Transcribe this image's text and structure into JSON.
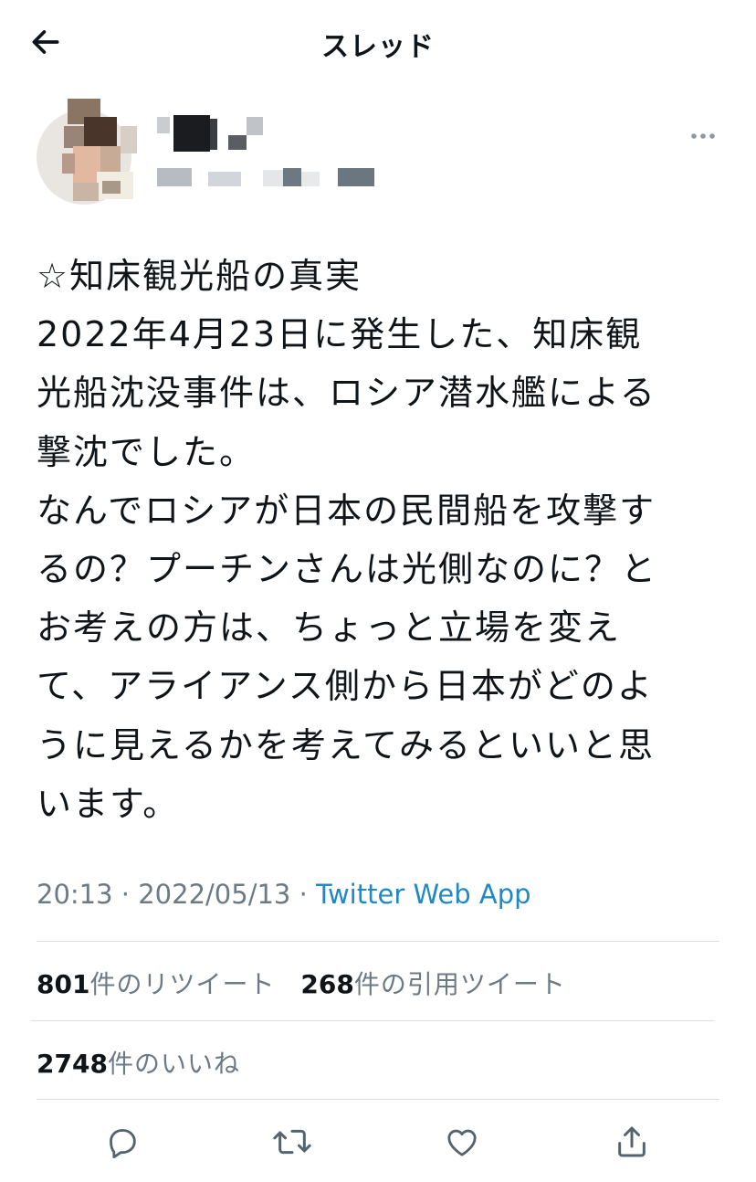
{
  "header": {
    "title": "スレッド"
  },
  "tweet": {
    "text": "☆知床観光船の真実\n2022年4月23日に発生した、知床観\n光船沈没事件は、ロシア潜水艦による\n撃沈でした。\nなんでロシアが日本の民間船を攻撃す\nるの？プーチンさんは光側なのに？と\nお考えの方は、ちょっと立場を変え\nて、アライアンス側から日本がどのよ\nうに見えるかを考えてみるといいと思\nいます。",
    "time": "20:13",
    "sep1": " · ",
    "date": "2022/05/13",
    "sep2": " · ",
    "source": "Twitter Web App"
  },
  "stats": {
    "retweets_count": "801",
    "retweets_label": "件のリツイート",
    "quotes_count": "268",
    "quotes_label": "件の引用ツイート",
    "likes_count": "2748",
    "likes_label": "件のいいね"
  },
  "icons": {
    "back": "arrow-left-icon",
    "more": "more-horizontal-icon",
    "reply": "reply-icon",
    "retweet": "retweet-icon",
    "like": "heart-icon",
    "share": "share-icon"
  },
  "colors": {
    "link": "#1d89c9",
    "secondary_text": "#6b7a85",
    "icon": "#536471"
  }
}
